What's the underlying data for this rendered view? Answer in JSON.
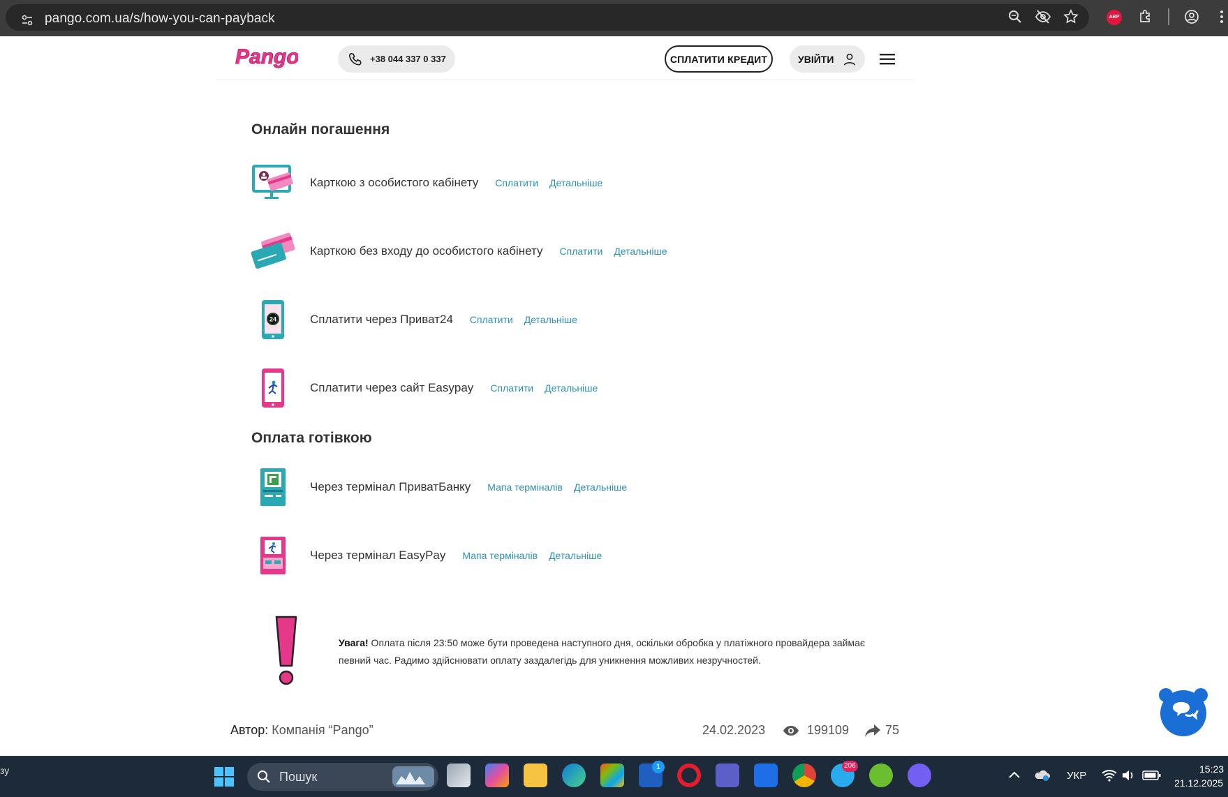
{
  "browser": {
    "url": "pango.com.ua/s/how-you-can-payback",
    "adblock_label": "ABP"
  },
  "header": {
    "logo_text": "Pango",
    "phone": "+38 044 337 0 337",
    "pay_credit": "СПЛАТИТИ КРЕДИТ",
    "login": "УВІЙТИ"
  },
  "online": {
    "title": "Онлайн погашення",
    "items": [
      {
        "label": "Карткою з особистого кабінету",
        "link1": "Сплатити",
        "link2": "Детальніше",
        "icon": "monitor-card-icon"
      },
      {
        "label": "Карткою без входу до особистого кабінету",
        "link1": "Сплатити",
        "link2": "Детальніше",
        "icon": "card-icon"
      },
      {
        "label": "Сплатити через Приват24",
        "link1": "Сплатити",
        "link2": "Детальніше",
        "icon": "privat24-phone-icon"
      },
      {
        "label": "Сплатити через сайт Easypay",
        "link1": "Сплатити",
        "link2": "Детальніше",
        "icon": "easypay-phone-icon"
      }
    ]
  },
  "cash": {
    "title": "Оплата готівкою",
    "items": [
      {
        "label": "Через термінал ПриватБанку",
        "link1": "Мапа терміналів",
        "link2": "Детальніше",
        "icon": "privat-terminal-icon"
      },
      {
        "label": "Через термінал EasyPay",
        "link1": "Мапа терміналів",
        "link2": "Детальніше",
        "icon": "easypay-terminal-icon"
      }
    ]
  },
  "warning": {
    "bold": "Увага!",
    "text": " Оплата після 23:50 може бути проведена наступного дня, оскільки обробка у платіжного провайдера займає певний час. Радимо здійснювати оплату заздалегідь для уникнення можливих незручностей."
  },
  "footer": {
    "author_label": "Автор:",
    "author": " Компанія “Pango”",
    "date": "24.02.2023",
    "views": "199109",
    "shares": "75"
  },
  "taskbar": {
    "search_placeholder": "Пошук",
    "lang": "УКР",
    "time": "15:23",
    "date": "21.12.2025",
    "telegram_badge": "206",
    "lingvo_badge": "1",
    "left_edge_text": "зу"
  },
  "colors": {
    "link": "#2b8fb5",
    "pink": "#e6388a",
    "teal": "#2aa9b4",
    "chat_blue": "#1a6fd6"
  }
}
